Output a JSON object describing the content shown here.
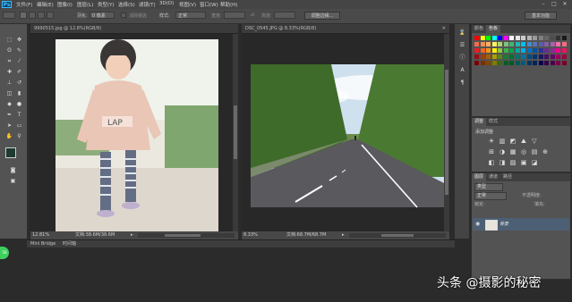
{
  "menubar": {
    "logo": "Ps",
    "items": [
      "文件(F)",
      "编辑(E)",
      "图像(I)",
      "图层(L)",
      "类型(Y)",
      "选择(S)",
      "滤镜(T)",
      "3D(D)",
      "视图(V)",
      "窗口(W)",
      "帮助(H)"
    ],
    "window_controls": [
      "–",
      "□",
      "✕"
    ]
  },
  "optbar": {
    "feather_label": "羽化:",
    "feather_value": "0 像素",
    "antialias_label": "消除锯齿",
    "style_label": "样式:",
    "style_value": "正常",
    "width_label": "宽度:",
    "height_label": "高度:",
    "refine_edge": "调整边缘...",
    "workspace": "基本功能"
  },
  "doc1": {
    "tab": "9990515.jpg @ 12.8%(RGB/8)",
    "zoom": "12.81%",
    "doc_info": "文档:38.6M/38.6M"
  },
  "doc2": {
    "tab": "DSC_0545.JPG @ 8.33%(RGB/8)",
    "zoom": "8.33%",
    "doc_info": "文档:68.7M/68.7M"
  },
  "bridge": {
    "tab1": "Mini Bridge",
    "tab2": "时间轴"
  },
  "swatches_panel": {
    "tabs": [
      "颜色",
      "色板"
    ],
    "colors": [
      "#ff0000",
      "#ffff00",
      "#00ff00",
      "#00ffff",
      "#0000ff",
      "#ff00ff",
      "#ffffff",
      "#e6e6e6",
      "#cccccc",
      "#b3b3b3",
      "#999999",
      "#808080",
      "#666666",
      "#4d4d4d",
      "#333333",
      "#1a1a1a",
      "#f26c4f",
      "#f68e56",
      "#fbaf5d",
      "#fff467",
      "#acd372",
      "#7cc576",
      "#3bb878",
      "#1abbb4",
      "#00bff3",
      "#438ccb",
      "#5574b9",
      "#605ca8",
      "#855fa8",
      "#a763a8",
      "#f06ea9",
      "#f26d7d",
      "#ed1c24",
      "#f26522",
      "#f7941d",
      "#fff200",
      "#8dc63f",
      "#39b54a",
      "#00a651",
      "#00a99d",
      "#00aeef",
      "#0072bc",
      "#0054a6",
      "#2e3192",
      "#662d91",
      "#92278f",
      "#ec008c",
      "#ed145b",
      "#9e0b0f",
      "#a0410d",
      "#a36209",
      "#aba000",
      "#598527",
      "#1a7b30",
      "#007236",
      "#00746b",
      "#0076a3",
      "#004b80",
      "#003471",
      "#1b1464",
      "#440e62",
      "#630460",
      "#9e005d",
      "#9e0039",
      "#790000",
      "#7b2e00",
      "#7d4900",
      "#827b00",
      "#406618",
      "#005e20",
      "#005826",
      "#005952",
      "#005b7f",
      "#003663",
      "#002157",
      "#0d004c",
      "#32004b",
      "#4b0049",
      "#7b0046",
      "#7a0026"
    ]
  },
  "adjust_panel": {
    "tabs": [
      "调整",
      "样式"
    ],
    "title": "添加调整",
    "row1": [
      "☀",
      "▥",
      "◩",
      "⛰",
      "▽"
    ],
    "row2": [
      "⊞",
      "◑",
      "▦",
      "◎",
      "▤",
      "⊕"
    ],
    "row3": [
      "◧",
      "◨",
      "▨",
      "▣",
      "◪"
    ]
  },
  "layers_panel": {
    "tabs": [
      "图层",
      "通道",
      "路径"
    ],
    "kind_label": "类型",
    "blend_mode": "正常",
    "opacity_label": "不透明度:",
    "lock_label": "锁定:",
    "fill_label": "填充:",
    "layer_name": "背景"
  },
  "watermark": "头条 @摄影的秘密",
  "badge_text": "58"
}
